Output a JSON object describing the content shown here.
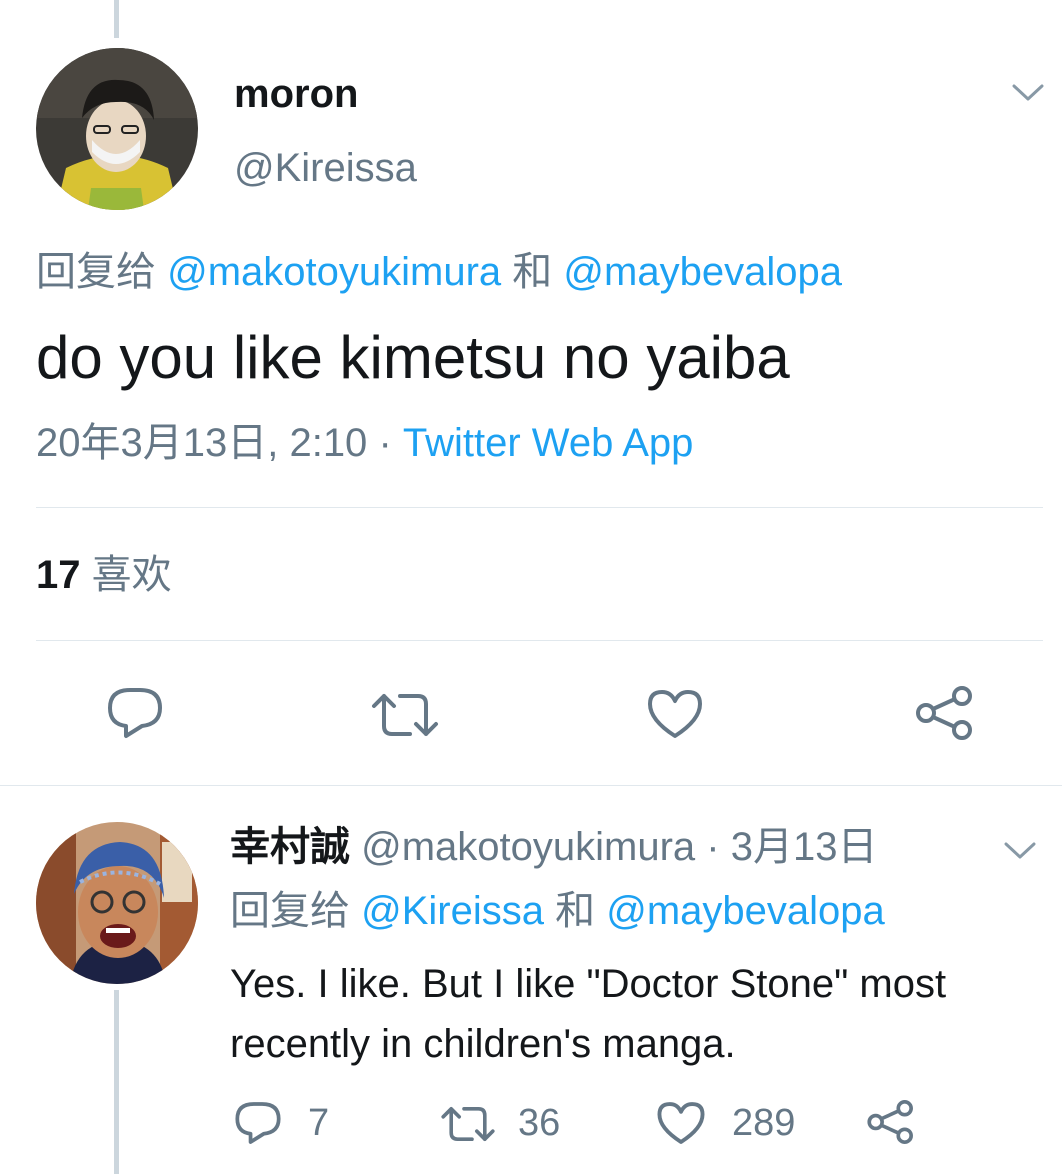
{
  "main_tweet": {
    "display_name": "moron",
    "handle": "@Kireissa",
    "reply_prefix": "回复给",
    "reply_user_1": "@makotoyukimura",
    "reply_and": "和",
    "reply_user_2": "@maybevalopa",
    "text": "do you like kimetsu no yaiba",
    "timestamp": "20年3月13日, 2:10",
    "separator": "·",
    "source": "Twitter Web App",
    "likes_count": "17",
    "likes_label": "喜欢",
    "actions": [
      "reply-icon",
      "retweet-icon",
      "like-icon",
      "share-icon"
    ]
  },
  "reply_tweet": {
    "display_name": "幸村誠",
    "handle": "@makotoyukimura",
    "separator": "·",
    "date": "3月13日",
    "reply_prefix": "回复给",
    "reply_user_1": "@Kireissa",
    "reply_and": "和",
    "reply_user_2": "@maybevalopa",
    "text_line_1": "Yes. I like. But I like \"Doctor Stone\" most",
    "text_line_2": "recently in children's manga.",
    "reply_count": "7",
    "retweet_count": "36",
    "like_count": "289"
  },
  "colors": {
    "link": "#1da1f2",
    "muted": "#657786",
    "icon": "#657786",
    "thread_line": "#ccd6dd"
  }
}
